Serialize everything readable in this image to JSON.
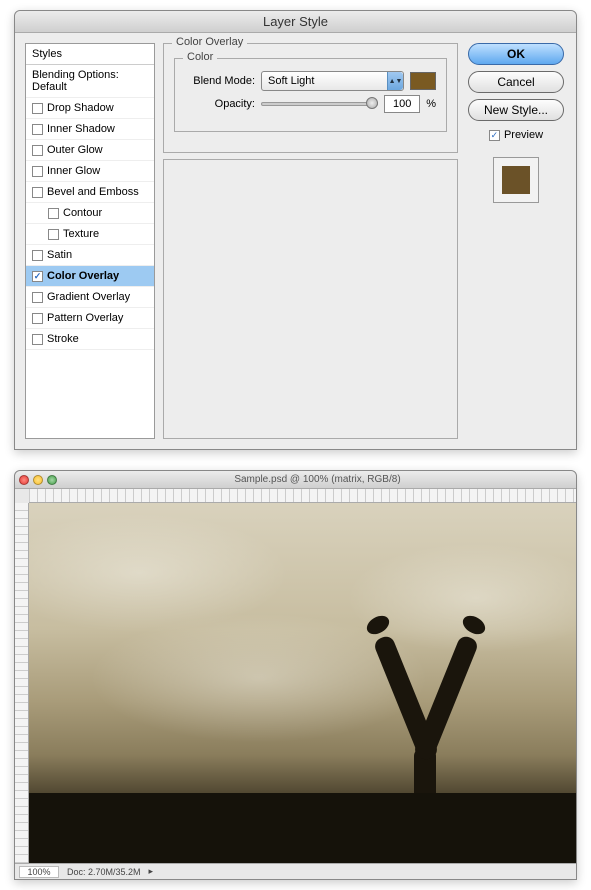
{
  "dialog": {
    "title": "Layer Style",
    "sidebar": {
      "header": "Styles",
      "blending": "Blending Options: Default",
      "items": [
        {
          "label": "Drop Shadow",
          "checked": false
        },
        {
          "label": "Inner Shadow",
          "checked": false
        },
        {
          "label": "Outer Glow",
          "checked": false
        },
        {
          "label": "Inner Glow",
          "checked": false
        },
        {
          "label": "Bevel and Emboss",
          "checked": false
        },
        {
          "label": "Contour",
          "checked": false,
          "indent": true
        },
        {
          "label": "Texture",
          "checked": false,
          "indent": true
        },
        {
          "label": "Satin",
          "checked": false
        },
        {
          "label": "Color Overlay",
          "checked": true,
          "active": true
        },
        {
          "label": "Gradient Overlay",
          "checked": false
        },
        {
          "label": "Pattern Overlay",
          "checked": false
        },
        {
          "label": "Stroke",
          "checked": false
        }
      ]
    },
    "panel": {
      "group_title": "Color Overlay",
      "subgroup_title": "Color",
      "blend_label": "Blend Mode:",
      "blend_value": "Soft Light",
      "color": "#7a5a22",
      "opacity_label": "Opacity:",
      "opacity_value": "100",
      "opacity_unit": "%"
    },
    "buttons": {
      "ok": "OK",
      "cancel": "Cancel",
      "newstyle": "New Style...",
      "preview": "Preview"
    },
    "preview_color": "#6b5228"
  },
  "document": {
    "title": "Sample.psd @ 100% (matrix, RGB/8)",
    "zoom": "100%",
    "docinfo": "Doc: 2.70M/35.2M"
  }
}
